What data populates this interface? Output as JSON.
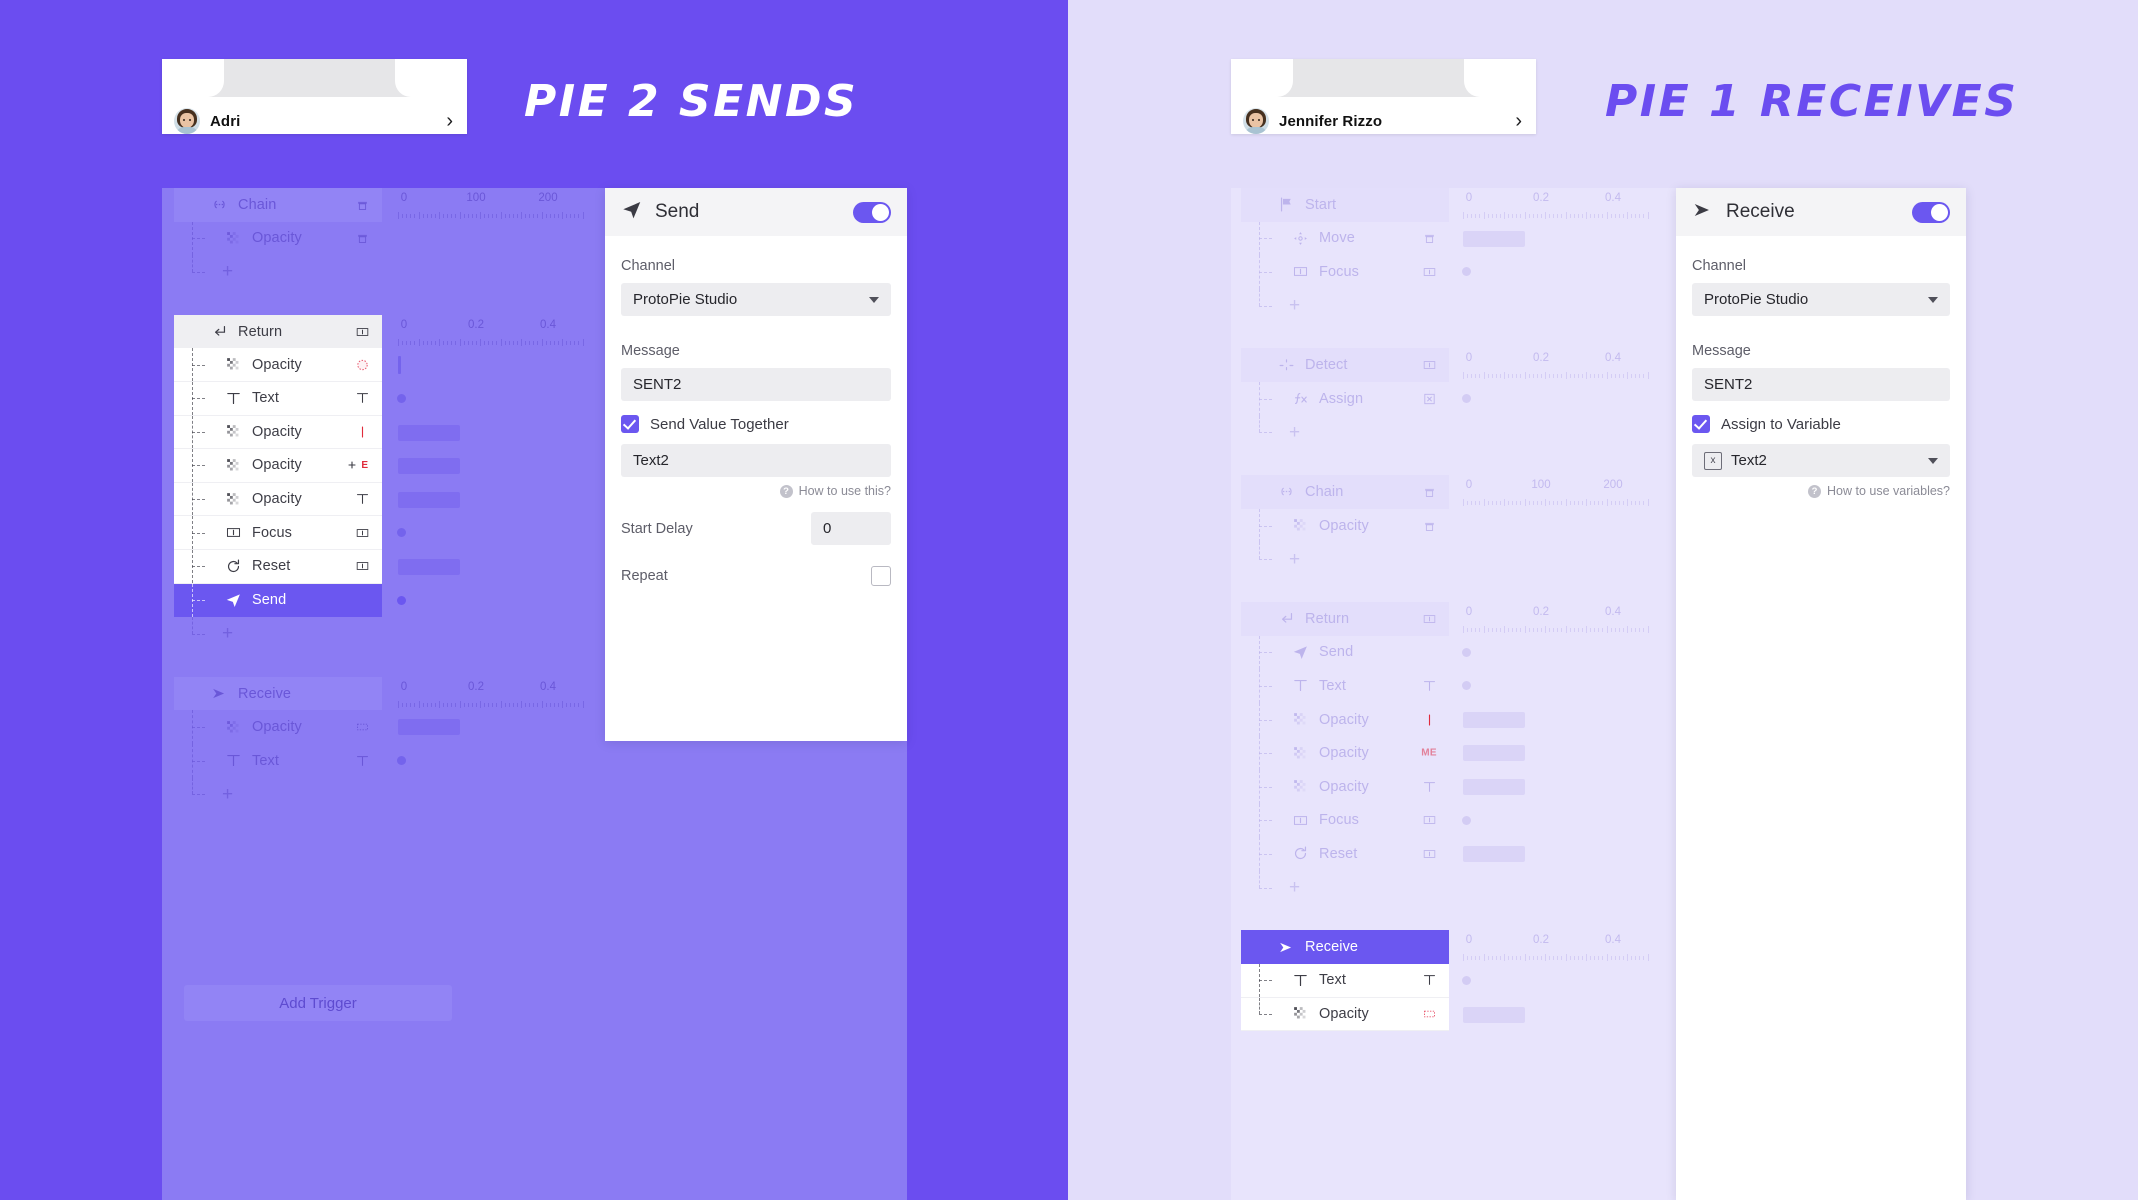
{
  "left": {
    "bg_color": "#6B4DF0",
    "headline": "PIE 2 SENDS",
    "phone": {
      "name": "Adri",
      "chevron": "›"
    },
    "add_trigger_label": "Add Trigger",
    "groups": [
      {
        "name": "Chain",
        "icon": "chain-icon",
        "end_icon": "bin-icon",
        "state": "dim",
        "ruler": [
          "0",
          "100",
          "200"
        ],
        "children": [
          {
            "label": "Opacity",
            "icon": "opacity-icon",
            "end_icon": "bin-icon",
            "state": "dim",
            "track": "none"
          },
          {
            "label": "+",
            "icon": "plus-icon",
            "state": "dim",
            "track": "none"
          }
        ]
      },
      {
        "name": "Return",
        "icon": "return-icon",
        "end_icon": "frame-icon",
        "state": "white-hdr",
        "ruler": [
          "0",
          "0.2",
          "0.4"
        ],
        "children": [
          {
            "label": "Opacity",
            "icon": "opacity-icon",
            "end_icon": "circle-dashed-icon",
            "state": "white",
            "track": "stick"
          },
          {
            "label": "Text",
            "icon": "text-icon",
            "end_icon": "text-icon",
            "state": "white",
            "track": "dot"
          },
          {
            "label": "Opacity",
            "icon": "opacity-icon",
            "end_icon": "cursor-icon",
            "state": "white",
            "track": "bar"
          },
          {
            "label": "Opacity",
            "icon": "opacity-icon",
            "end_icon": "plus-e-icon",
            "state": "white",
            "track": "bar"
          },
          {
            "label": "Opacity",
            "icon": "opacity-icon",
            "end_icon": "text-icon",
            "state": "white",
            "track": "bar"
          },
          {
            "label": "Focus",
            "icon": "frame-icon",
            "end_icon": "frame-icon",
            "state": "white",
            "track": "dot"
          },
          {
            "label": "Reset",
            "icon": "reset-icon",
            "end_icon": "frame-icon",
            "state": "white",
            "track": "bar"
          },
          {
            "label": "Send",
            "icon": "send-icon",
            "end_icon": "",
            "state": "selected",
            "track": "dot-bright"
          },
          {
            "label": "+",
            "icon": "plus-icon",
            "state": "dim",
            "track": "none"
          }
        ]
      },
      {
        "name": "Receive",
        "icon": "receive-icon",
        "end_icon": "",
        "state": "dim",
        "ruler": [
          "0",
          "0.2",
          "0.4"
        ],
        "children": [
          {
            "label": "Opacity",
            "icon": "opacity-icon",
            "end_icon": "rect-dashed-icon",
            "state": "dim",
            "track": "bar"
          },
          {
            "label": "Text",
            "icon": "text-icon",
            "end_icon": "text-icon",
            "state": "dim",
            "track": "dot"
          },
          {
            "label": "+",
            "icon": "plus-icon",
            "state": "dim",
            "track": "none"
          }
        ]
      }
    ],
    "panel": {
      "title": "Send",
      "icon": "send-icon",
      "toggle_on": true,
      "channel_label": "Channel",
      "channel_value": "ProtoPie Studio",
      "message_label": "Message",
      "message_value": "SENT2",
      "checkbox_label": "Send Value Together",
      "checkbox_checked": true,
      "value_value": "Text2",
      "help_text": "How to use this?",
      "start_delay_label": "Start Delay",
      "start_delay_value": "0",
      "repeat_label": "Repeat",
      "repeat_checked": false
    }
  },
  "right": {
    "bg_color": "#E2DDFA",
    "headline": "PIE 1 RECEIVES",
    "phone": {
      "name": "Jennifer Rizzo",
      "chevron": "›"
    },
    "groups": [
      {
        "name": "Start",
        "icon": "flag-icon",
        "end_icon": "",
        "state": "dim",
        "ruler": [
          "0",
          "0.2",
          "0.4"
        ],
        "children": [
          {
            "label": "Move",
            "icon": "move-icon",
            "end_icon": "bin-icon",
            "state": "dim",
            "track": "bar"
          },
          {
            "label": "Focus",
            "icon": "frame-icon",
            "end_icon": "frame-icon",
            "state": "dim",
            "track": "dot"
          },
          {
            "label": "+",
            "icon": "plus-icon",
            "state": "dim",
            "track": "none"
          }
        ]
      },
      {
        "name": "Detect",
        "icon": "detect-icon",
        "end_icon": "frame-icon",
        "state": "dim",
        "ruler": [
          "0",
          "0.2",
          "0.4"
        ],
        "children": [
          {
            "label": "Assign",
            "icon": "fx-icon",
            "end_icon": "x-box-icon",
            "state": "dim",
            "track": "dot"
          },
          {
            "label": "+",
            "icon": "plus-icon",
            "state": "dim",
            "track": "none"
          }
        ]
      },
      {
        "name": "Chain",
        "icon": "chain-icon",
        "end_icon": "bin-icon",
        "state": "dim",
        "ruler": [
          "0",
          "100",
          "200"
        ],
        "children": [
          {
            "label": "Opacity",
            "icon": "opacity-icon",
            "end_icon": "bin-icon",
            "state": "dim",
            "track": "none"
          },
          {
            "label": "+",
            "icon": "plus-icon",
            "state": "dim",
            "track": "none"
          }
        ]
      },
      {
        "name": "Return",
        "icon": "return-icon",
        "end_icon": "frame-icon",
        "state": "dim",
        "ruler": [
          "0",
          "0.2",
          "0.4"
        ],
        "children": [
          {
            "label": "Send",
            "icon": "send-icon",
            "end_icon": "",
            "state": "dim",
            "track": "dot"
          },
          {
            "label": "Text",
            "icon": "text-icon",
            "end_icon": "text-icon",
            "state": "dim",
            "track": "dot"
          },
          {
            "label": "Opacity",
            "icon": "opacity-icon",
            "end_icon": "cursor-icon",
            "state": "dim",
            "track": "bar"
          },
          {
            "label": "Opacity",
            "icon": "opacity-icon",
            "end_icon": "me-icon",
            "state": "dim",
            "track": "bar"
          },
          {
            "label": "Opacity",
            "icon": "opacity-icon",
            "end_icon": "text-icon",
            "state": "dim",
            "track": "bar"
          },
          {
            "label": "Focus",
            "icon": "frame-icon",
            "end_icon": "frame-icon",
            "state": "dim",
            "track": "dot"
          },
          {
            "label": "Reset",
            "icon": "reset-icon",
            "end_icon": "frame-icon",
            "state": "dim",
            "track": "bar"
          },
          {
            "label": "+",
            "icon": "plus-icon",
            "state": "dim",
            "track": "none"
          }
        ]
      },
      {
        "name": "Receive",
        "icon": "receive-icon",
        "end_icon": "",
        "state": "selected",
        "ruler": [
          "0",
          "0.2",
          "0.4"
        ],
        "children": [
          {
            "label": "Text",
            "icon": "text-icon",
            "end_icon": "text-icon",
            "state": "white",
            "track": "dot"
          },
          {
            "label": "Opacity",
            "icon": "opacity-icon",
            "end_icon": "rect-dashed-red-icon",
            "state": "white",
            "track": "bar"
          }
        ]
      }
    ],
    "panel": {
      "title": "Receive",
      "icon": "receive-icon",
      "toggle_on": true,
      "channel_label": "Channel",
      "channel_value": "ProtoPie Studio",
      "message_label": "Message",
      "message_value": "SENT2",
      "checkbox_label": "Assign to Variable",
      "checkbox_checked": true,
      "variable_value": "Text2",
      "variable_badge": "x",
      "help_text": "How to use variables?"
    }
  }
}
